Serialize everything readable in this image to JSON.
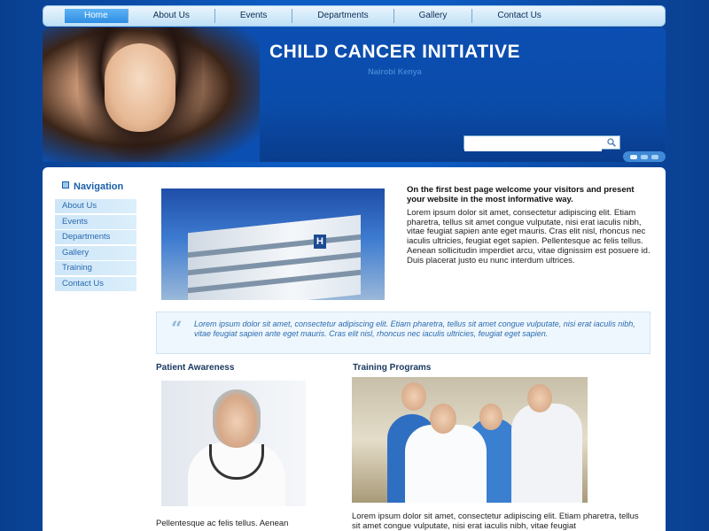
{
  "topnav": {
    "items": [
      {
        "label": "Home",
        "active": true
      },
      {
        "label": "About Us"
      },
      {
        "label": "Events"
      },
      {
        "label": "Departments"
      },
      {
        "label": "Gallery"
      },
      {
        "label": "Contact Us"
      }
    ]
  },
  "header": {
    "title": "CHILD CANCER INITIATIVE",
    "subtitle": "Nairobi Kenya",
    "search_placeholder": ""
  },
  "sidebar": {
    "heading": "Navigation",
    "items": [
      {
        "label": "About Us"
      },
      {
        "label": "Events"
      },
      {
        "label": "Departments"
      },
      {
        "label": "Gallery"
      },
      {
        "label": "Training"
      },
      {
        "label": "Contact Us"
      }
    ]
  },
  "main": {
    "intro_heading": "On the first best page  welcome your visitors and present your website in the most informative way.",
    "intro_body": "Lorem ipsum dolor sit amet, consectetur adipiscing elit. Etiam pharetra, tellus sit amet congue vulputate, nisi erat iaculis nibh, vitae feugiat sapien ante eget mauris. Cras elit nisl, rhoncus nec iaculis ultricies, feugiat eget sapien. Pellentesque ac felis tellus. Aenean sollicitudin imperdiet arcu, vitae dignissim est posuere id. Duis placerat justo eu nunc interdum ultrices.",
    "hospital_sign": "H",
    "quote_mark": "“",
    "quote": "Lorem ipsum dolor sit amet, consectetur adipiscing elit. Etiam pharetra, tellus sit amet congue vulputate, nisi erat iaculis nibh, vitae feugiat sapien ante eget mauris. Cras elit nisl, rhoncus nec iaculis ultricies, feugiat eget sapien.",
    "col1_heading": "Patient Awareness",
    "col1_text": "Pellentesque ac felis tellus. Aenean",
    "col2_heading": "Training Programs",
    "col2_text": "Lorem ipsum dolor sit amet, consectetur adipiscing elit. Etiam pharetra, tellus sit amet congue vulputate, nisi erat iaculis nibh, vitae feugiat"
  },
  "colors": {
    "background": "#0d5cc4",
    "header": "#0c4fb2",
    "accent_link": "#2a6ab0",
    "nav_active": "#2f8de3"
  },
  "icons": {
    "search": "search-icon",
    "quote": "quote-icon"
  }
}
